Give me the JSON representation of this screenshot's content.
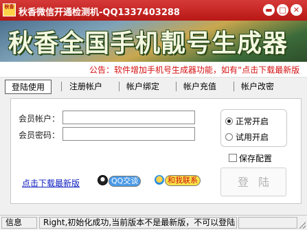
{
  "window": {
    "title": "秋香微信开通检测机-QQ1337403288",
    "icon_text": "秋香"
  },
  "banner": {
    "title": "秋香全国手机靓号生成器"
  },
  "notice": {
    "text": "公告：软件增加手机号生成器功能，如有“点击下载最新版"
  },
  "tabs": [
    {
      "label": "登陆使用",
      "active": true
    },
    {
      "label": "注册帐户",
      "active": false
    },
    {
      "label": "帐户绑定",
      "active": false
    },
    {
      "label": "帐户充值",
      "active": false
    },
    {
      "label": "帐户改密",
      "active": false
    }
  ],
  "form": {
    "account_label": "会员帐户：",
    "account_value": "",
    "password_label": "会员密码：",
    "password_value": ""
  },
  "options": {
    "normal_start": "正常开启",
    "trial_start": "试用开启",
    "selected": "normal_start",
    "save_config": "保存配置",
    "save_config_checked": false
  },
  "actions": {
    "login_label": "登陆",
    "download_link": "点击下载最新版",
    "qq_chat_label": "QQ交谈",
    "contact_label": "和我联系"
  },
  "status": {
    "section_label": "信息",
    "message": "Right,初始化成功,当前版本不是最新版，不可以登陆!"
  },
  "colors": {
    "titlebar": "#c62322",
    "notice_text": "#d41010",
    "link": "#1020c0"
  }
}
